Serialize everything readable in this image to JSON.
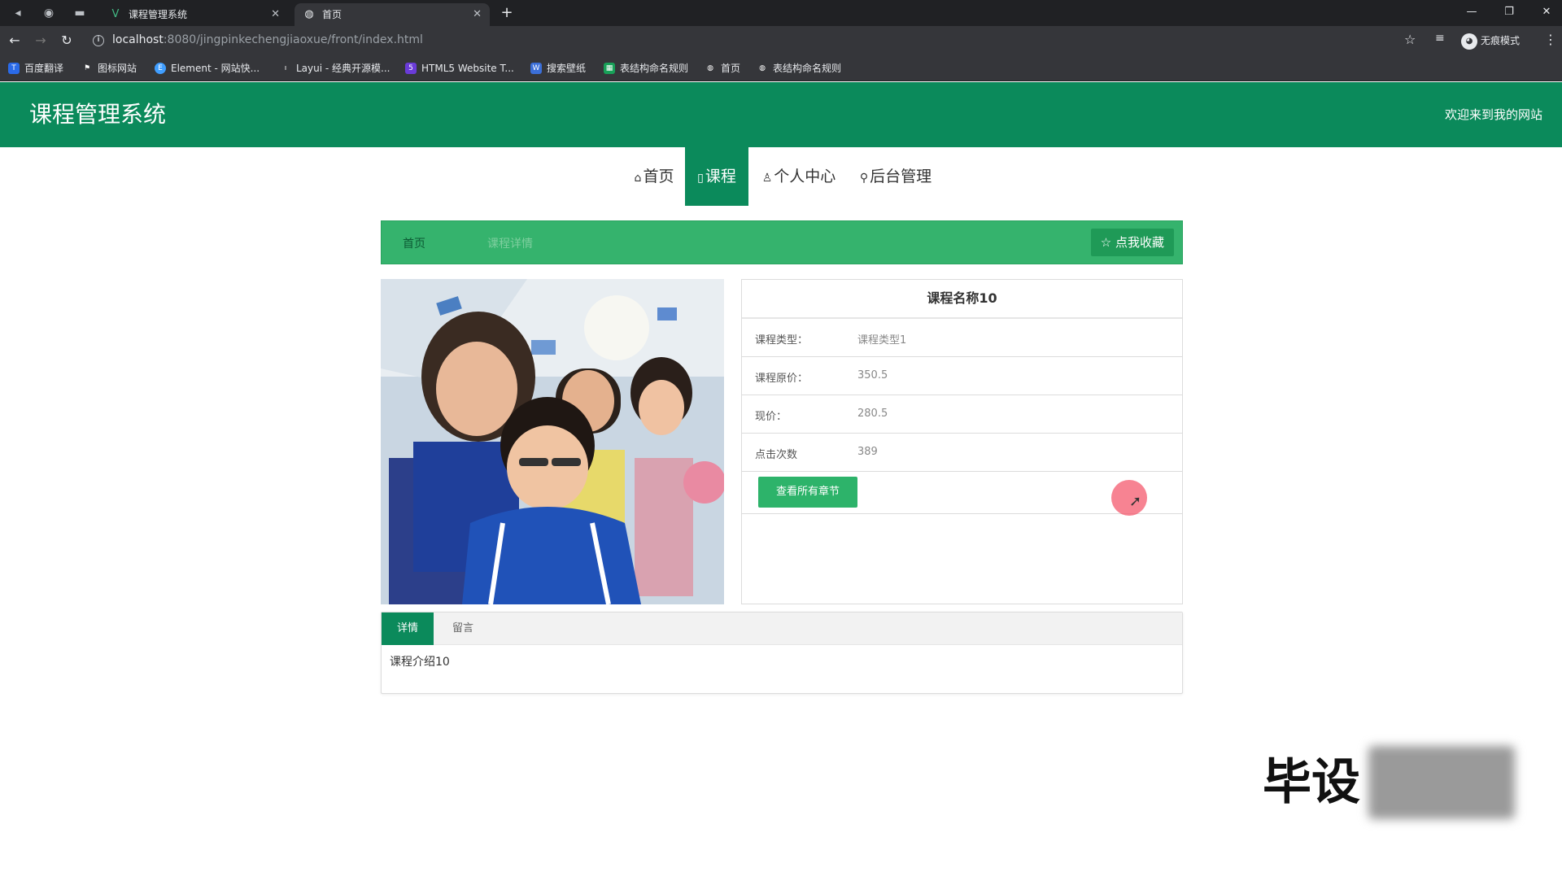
{
  "browser": {
    "tabs": [
      {
        "title": "课程管理系统",
        "icon": "vue-logo-icon"
      },
      {
        "title": "首页",
        "icon": "globe-icon"
      }
    ],
    "url_host": "localhost",
    "url_rest": ":8080/jingpinkechengjiaoxue/front/index.html",
    "profile_label": "无痕模式",
    "bookmarks": [
      {
        "label": "百度翻译",
        "color": "#2a6ae8"
      },
      {
        "label": "图标网站",
        "color": "#444444"
      },
      {
        "label": "Element - 网站快...",
        "color": "#409eff"
      },
      {
        "label": "Layui - 经典开源模...",
        "color": "#555555"
      },
      {
        "label": "HTML5 Website T...",
        "color": "#6a3bd8"
      },
      {
        "label": "搜索壁纸",
        "color": "#3b6fd8"
      },
      {
        "label": "表结构命名规则",
        "color": "#18a058"
      },
      {
        "label": "首页",
        "color": "#444444"
      },
      {
        "label": "表结构命名规则",
        "color": "#444444"
      }
    ]
  },
  "header": {
    "title": "课程管理系统",
    "welcome": "欢迎来到我的网站"
  },
  "nav": {
    "items": [
      {
        "label": "首页",
        "icon": "home-icon"
      },
      {
        "label": "课程",
        "icon": "course-icon"
      },
      {
        "label": "个人中心",
        "icon": "user-icon"
      },
      {
        "label": "后台管理",
        "icon": "link-icon"
      }
    ],
    "active": "课程"
  },
  "crumb": {
    "home": "首页",
    "current": "课程详情",
    "favorite_label": "☆ 点我收藏"
  },
  "course": {
    "name": "课程名称10",
    "fields": [
      {
        "label": "课程类型：",
        "value": "课程类型1"
      },
      {
        "label": "课程原价：",
        "value": "350.5"
      },
      {
        "label": "现价：",
        "value": "280.5"
      },
      {
        "label": "点击次数",
        "value": "389"
      }
    ],
    "chapters_button": "查看所有章节"
  },
  "detail_tabs": {
    "tabs": [
      "详情",
      "留言"
    ],
    "active": "详情",
    "content": "课程介绍10"
  },
  "watermark": {
    "text": "毕设"
  }
}
